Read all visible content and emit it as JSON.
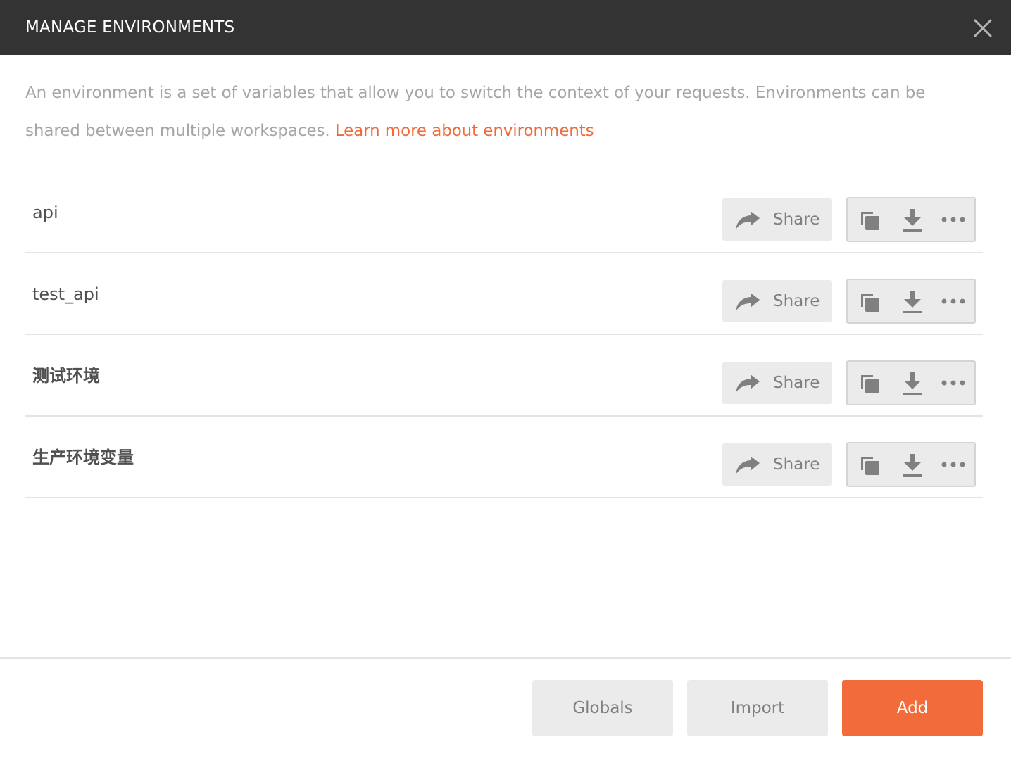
{
  "header": {
    "title": "MANAGE ENVIRONMENTS",
    "close_icon": "close-icon"
  },
  "description": {
    "text": "An environment is a set of variables that allow you to switch the context of your requests. Environments can be shared between multiple workspaces.",
    "link_text": "Learn more about environments"
  },
  "environments": [
    {
      "name": "api",
      "share_label": "Share"
    },
    {
      "name": "test_api",
      "share_label": "Share"
    },
    {
      "name": "测试环境",
      "share_label": "Share"
    },
    {
      "name": "生产环境变量",
      "share_label": "Share"
    }
  ],
  "icons": {
    "share": "share-arrow-icon",
    "duplicate": "duplicate-icon",
    "download": "download-icon",
    "more": "more-options-icon"
  },
  "footer": {
    "globals_label": "Globals",
    "import_label": "Import",
    "add_label": "Add"
  },
  "colors": {
    "header_bg": "#333333",
    "accent": "#f26b3a",
    "link": "#ef6c3a",
    "muted_text": "#a6a6a6",
    "button_bg": "#ebebeb"
  }
}
